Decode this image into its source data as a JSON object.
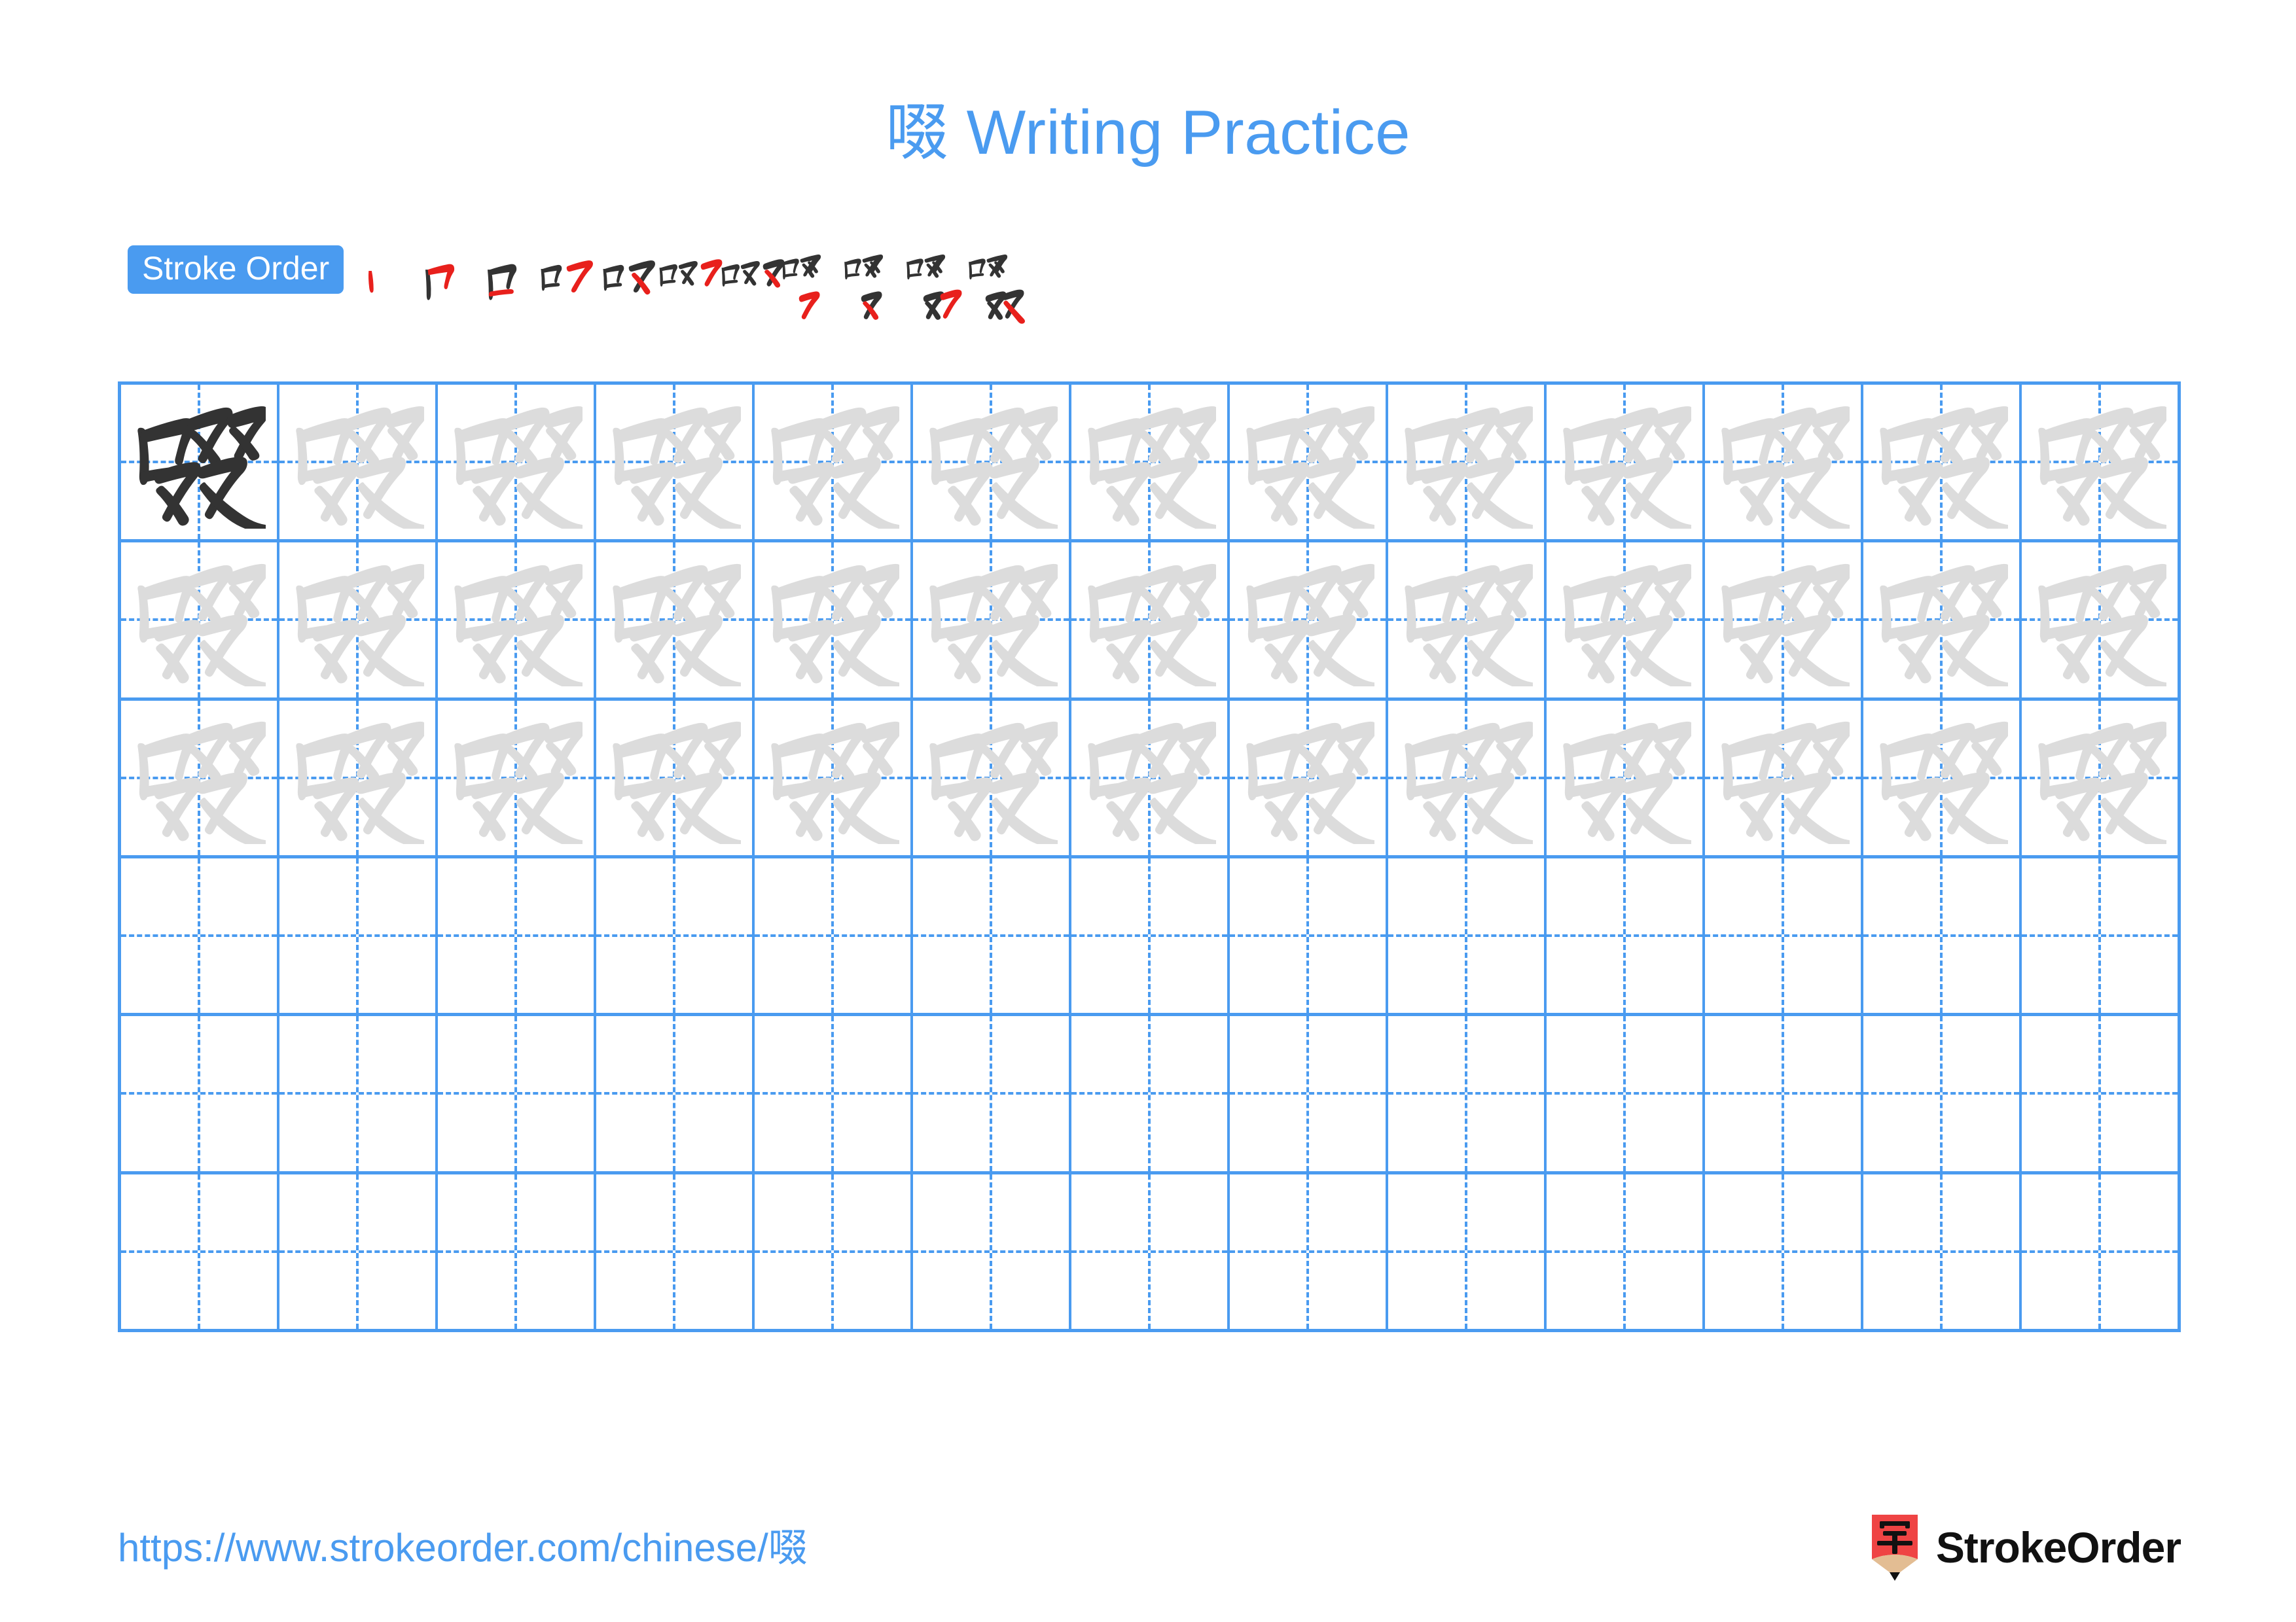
{
  "character": "啜",
  "title": "啜 Writing Practice",
  "stroke_order": {
    "label": "Stroke Order",
    "badge_color": "#4a9bf0",
    "total_strokes": 11,
    "steps": [
      {
        "index": 1,
        "new_stroke": "dot",
        "cumulative": "丶"
      },
      {
        "index": 2,
        "new_stroke": "horizontal-fold",
        "cumulative": "冂"
      },
      {
        "index": 3,
        "new_stroke": "horizontal",
        "cumulative": "口"
      },
      {
        "index": 4,
        "new_stroke": "fold",
        "cumulative": "口フ"
      },
      {
        "index": 5,
        "new_stroke": "press",
        "cumulative": "口又"
      },
      {
        "index": 6,
        "new_stroke": "fold",
        "cumulative": "口又フ"
      },
      {
        "index": 7,
        "new_stroke": "press",
        "cumulative": "口双"
      },
      {
        "index": 8,
        "new_stroke": "fold",
        "cumulative": "啜-partial-8"
      },
      {
        "index": 9,
        "new_stroke": "press",
        "cumulative": "啜-partial-9"
      },
      {
        "index": 10,
        "new_stroke": "fold",
        "cumulative": "啜-partial-10"
      },
      {
        "index": 11,
        "new_stroke": "press",
        "cumulative": "啜"
      }
    ]
  },
  "grid": {
    "columns": 13,
    "rows": 6,
    "line_color": "#4a9bf0",
    "guide_color": "#4a9bf0",
    "traced_char_color": "#dcdcdc",
    "model_char_color": "#333333",
    "rows_detail": [
      {
        "row": 1,
        "fill": "model-then-trace",
        "model_cells": 1,
        "trace_cells": 12
      },
      {
        "row": 2,
        "fill": "trace",
        "model_cells": 0,
        "trace_cells": 13
      },
      {
        "row": 3,
        "fill": "trace",
        "model_cells": 0,
        "trace_cells": 13
      },
      {
        "row": 4,
        "fill": "empty",
        "model_cells": 0,
        "trace_cells": 0
      },
      {
        "row": 5,
        "fill": "empty",
        "model_cells": 0,
        "trace_cells": 0
      },
      {
        "row": 6,
        "fill": "empty",
        "model_cells": 0,
        "trace_cells": 0
      }
    ]
  },
  "footer": {
    "url": "https://www.strokeorder.com/chinese/啜",
    "url_color": "#4a9bf0",
    "brand_name": "StrokeOrder",
    "logo_glyph": "字",
    "logo_body_color": "#ef4444",
    "logo_wood_color": "#e3bd93",
    "logo_tip_color": "#111111"
  }
}
